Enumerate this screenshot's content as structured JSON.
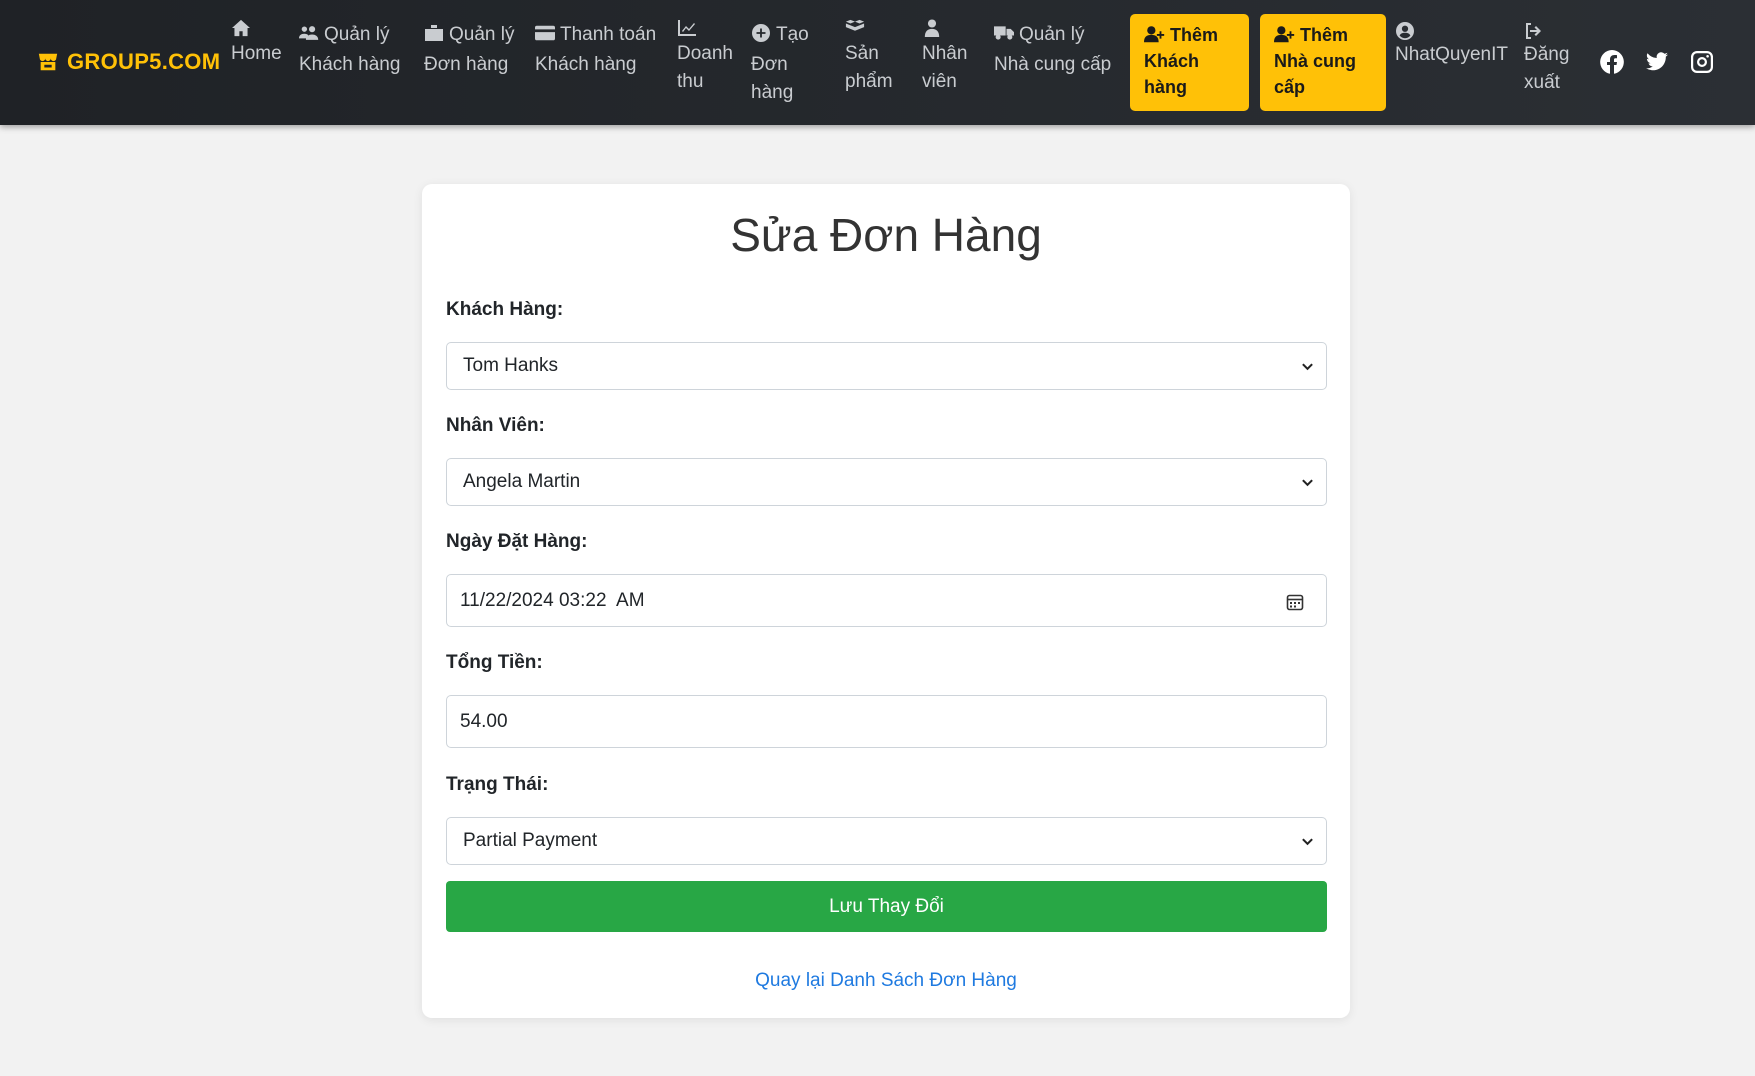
{
  "brand": {
    "name": "GROUP5.COM",
    "icon": "store-icon"
  },
  "nav": {
    "home": "Home",
    "customers": [
      "Quản lý",
      "Khách hàng"
    ],
    "orders": [
      "Quản lý",
      "Đơn hàng"
    ],
    "payments": [
      "Thanh toán",
      "Khách hàng"
    ],
    "revenue": [
      "Doanh",
      "thu"
    ],
    "create_order": [
      "Tạo",
      "Đơn",
      "hàng"
    ],
    "products": [
      "Sản",
      "phẩm"
    ],
    "staff": [
      "Nhân",
      "viên"
    ],
    "suppliers": [
      "Quản lý",
      "Nhà cung cấp"
    ],
    "add_customer": [
      "Thêm",
      "Khách",
      "hàng"
    ],
    "add_supplier": [
      "Thêm",
      "Nhà cung",
      "cấp"
    ],
    "user": "NhatQuyenIT",
    "logout": [
      "Đăng",
      "xuất"
    ]
  },
  "social": [
    "facebook-icon",
    "twitter-icon",
    "instagram-icon"
  ],
  "form": {
    "title": "Sửa Đơn Hàng",
    "customer_label": "Khách Hàng:",
    "customer_value": "Tom Hanks",
    "staff_label": "Nhân Viên:",
    "staff_value": "Angela Martin",
    "date_label": "Ngày Đặt Hàng:",
    "date_value": "11/22/2024 03:22  AM",
    "total_label": "Tổng Tiền:",
    "total_value": "54.00",
    "status_label": "Trạng Thái:",
    "status_value": "Partial Payment",
    "save_label": "Lưu Thay Đổi",
    "back_label": "Quay lại Danh Sách Đơn Hàng"
  },
  "colors": {
    "accent": "#ffc107",
    "save": "#28a745",
    "link": "#1f7ae0",
    "navbar": "#25292d"
  }
}
